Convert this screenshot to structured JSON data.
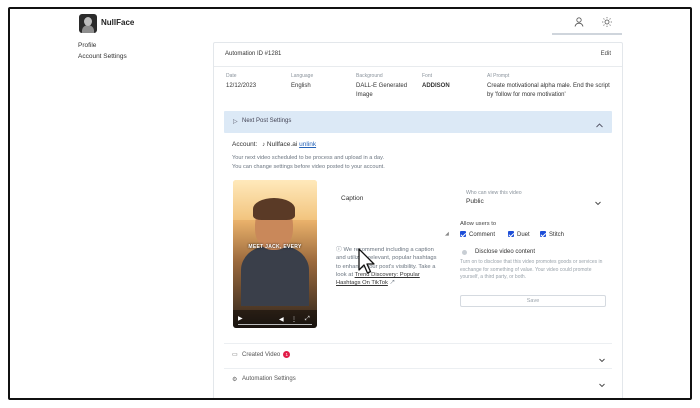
{
  "app": {
    "name": "NullFace"
  },
  "sidebar": {
    "items": [
      {
        "label": "Profile"
      },
      {
        "label": "Account Settings"
      }
    ]
  },
  "automation": {
    "title": "Automation ID #1281",
    "edit_label": "Edit",
    "meta": [
      {
        "key": "Date",
        "value": "12/12/2023"
      },
      {
        "key": "Language",
        "value": "English"
      },
      {
        "key": "Background",
        "value": "DALL-E Generated Image"
      },
      {
        "key": "Font",
        "value": "ADDISON"
      },
      {
        "key": "AI Prompt",
        "value": "Create motivational alpha male. End the script by 'follow for more motivation'"
      }
    ]
  },
  "next_post": {
    "label": "Next Post Settings",
    "account_label": "Account:",
    "account_name": "Nullface.ai",
    "unlink_label": "unlink",
    "info_lines": [
      "Your next video scheduled to be process and upload in a day.",
      "You can change settings before video posted to your account."
    ],
    "video_overlay_text": "MEET JACK, EVERY",
    "caption_label": "Caption",
    "recommendation": {
      "text_a": "We recommend including a caption and utilizing relevant, popular hashtags to enhance your post's visibility. Take a look at ",
      "link": "Trend Discovery: Popular Hashtags On TikTok"
    },
    "who_can_view_label": "Who can view this video",
    "who_can_view_value": "Public",
    "allow_users_label": "Allow users to",
    "allow_options": [
      {
        "label": "Comment",
        "checked": true
      },
      {
        "label": "Duet",
        "checked": true
      },
      {
        "label": "Stitch",
        "checked": true
      }
    ],
    "disclose_title": "Disclose video content",
    "disclose_text": "Turn on to disclose that this video promotes goods or services in exchange for something of value. Your video could promote yourself, a third party, or both.",
    "save_label": "Save"
  },
  "created_videos": {
    "label": "Created Video",
    "count": "1"
  },
  "automation_settings": {
    "label": "Automation Settings"
  },
  "colors": {
    "accent": "#2563b8",
    "banner": "#dce9f6",
    "badge": "#e11d48",
    "checkbox": "#1d4ed8"
  }
}
